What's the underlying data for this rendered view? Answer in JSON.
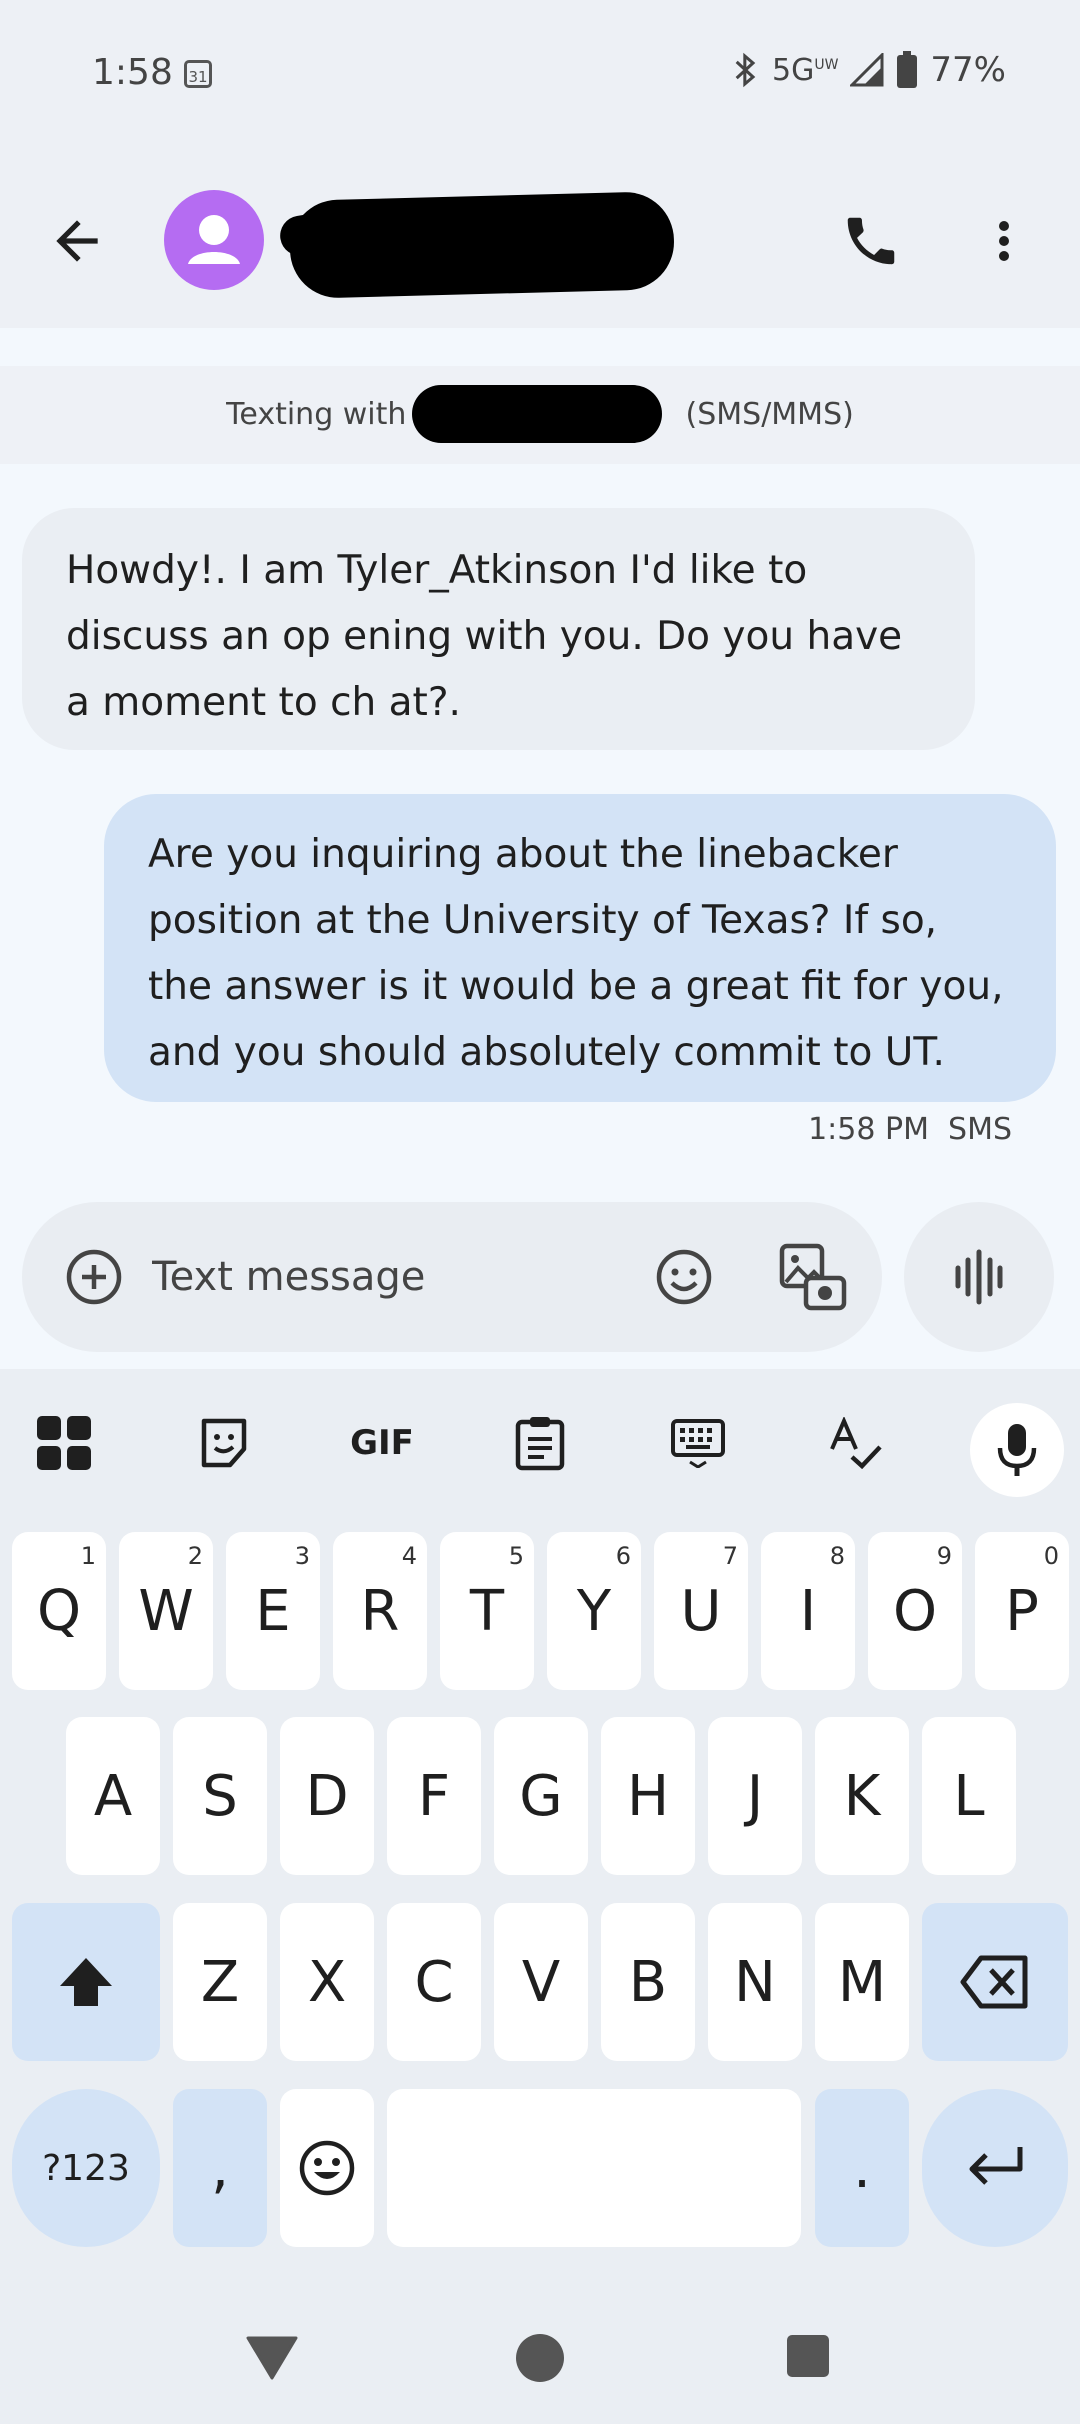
{
  "status_bar": {
    "time": "1:58",
    "calendar_day": "31",
    "network": "5G",
    "network_sub": "UW",
    "battery": "77%"
  },
  "header": {
    "contact_name": ""
  },
  "banner": {
    "prefix": "Texting with",
    "suffix": "(SMS/MMS)"
  },
  "messages": [
    {
      "direction": "incoming",
      "text": "Howdy!. I am Tyler_Atkinson I'd like to discuss an op ening with you. Do you have a moment to ch at?."
    },
    {
      "direction": "outgoing",
      "text": "Are you inquiring about the linebacker position at the University of Texas? If so, the answer is it would be a great fit for you, and you should absolutely commit to UT."
    }
  ],
  "timestamp": "1:58 PM  SMS",
  "compose": {
    "placeholder": "Text message"
  },
  "keyboard": {
    "toolbar": {
      "gif_label": "GIF"
    },
    "row1": [
      {
        "key": "Q",
        "hint": "1"
      },
      {
        "key": "W",
        "hint": "2"
      },
      {
        "key": "E",
        "hint": "3"
      },
      {
        "key": "R",
        "hint": "4"
      },
      {
        "key": "T",
        "hint": "5"
      },
      {
        "key": "Y",
        "hint": "6"
      },
      {
        "key": "U",
        "hint": "7"
      },
      {
        "key": "I",
        "hint": "8"
      },
      {
        "key": "O",
        "hint": "9"
      },
      {
        "key": "P",
        "hint": "0"
      }
    ],
    "row2": [
      "A",
      "S",
      "D",
      "F",
      "G",
      "H",
      "J",
      "K",
      "L"
    ],
    "row3": [
      "Z",
      "X",
      "C",
      "V",
      "B",
      "N",
      "M"
    ],
    "symbols_label": "?123",
    "comma_label": ",",
    "period_label": "."
  },
  "colors": {
    "avatar": "#b56cf2",
    "outgoing_bubble": "#d3e3f6",
    "incoming_bubble": "#eaeef3"
  }
}
